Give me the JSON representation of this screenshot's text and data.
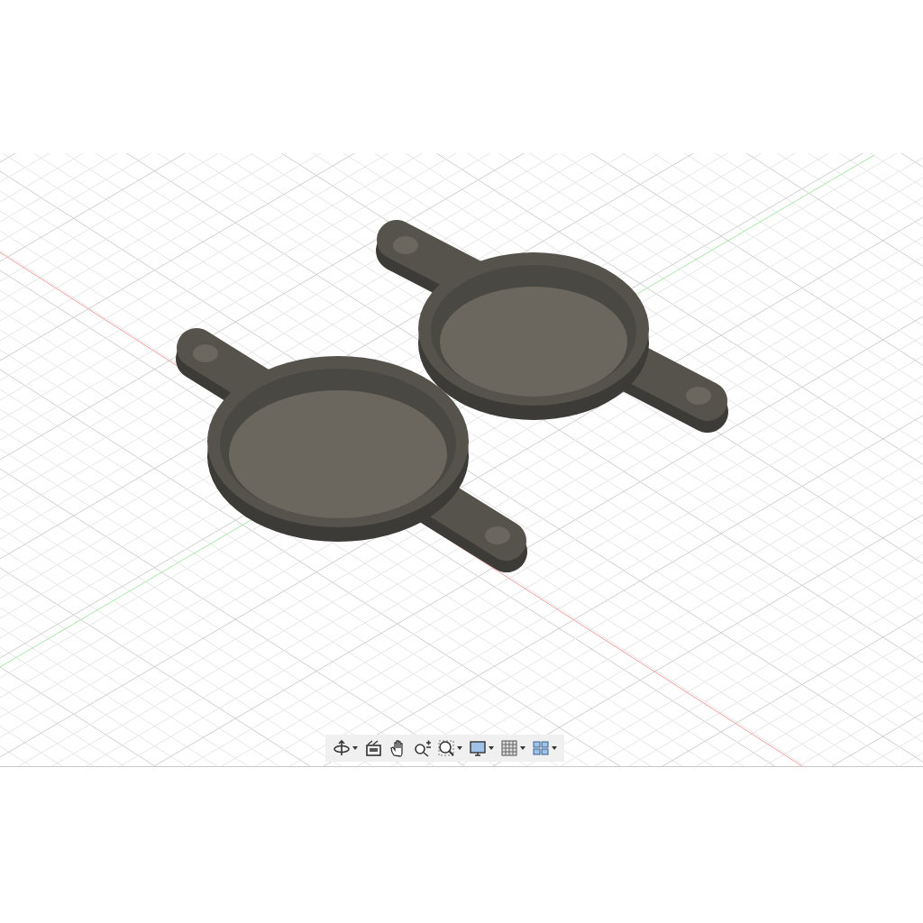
{
  "viewport": {
    "toolbar": [
      {
        "kind": "orbit",
        "dropdown": true
      },
      {
        "kind": "look-at",
        "dropdown": false
      },
      {
        "kind": "pan",
        "dropdown": false
      },
      {
        "kind": "zoom",
        "dropdown": false
      },
      {
        "kind": "fit",
        "dropdown": true
      },
      {
        "kind": "display",
        "dropdown": true
      },
      {
        "kind": "grid",
        "dropdown": true
      },
      {
        "kind": "viewports",
        "dropdown": true
      }
    ]
  }
}
